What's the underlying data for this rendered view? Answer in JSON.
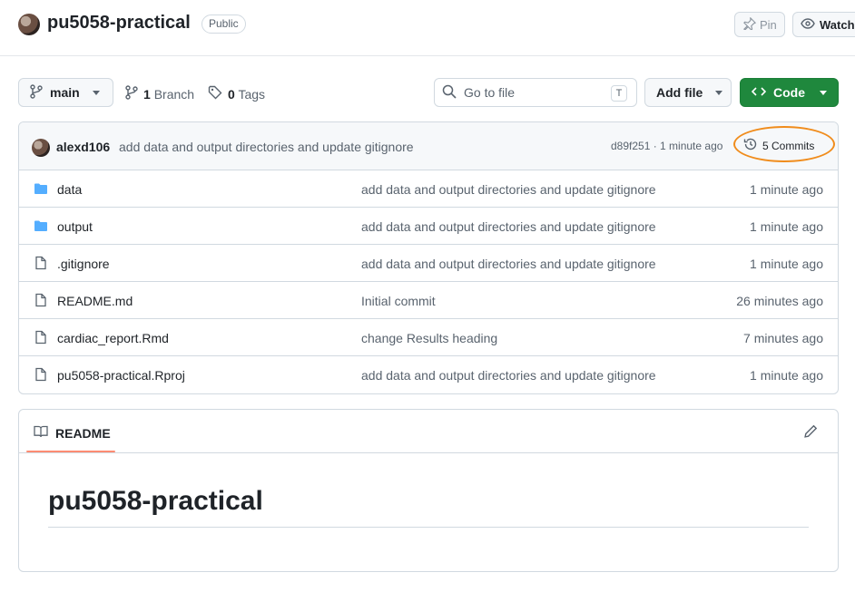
{
  "header": {
    "repo_name": "pu5058-practical",
    "visibility": "Public",
    "pin_label": "Pin",
    "watch_label": "Watch"
  },
  "toolbar": {
    "branch": "main",
    "branch_count": "1",
    "branch_label": "Branch",
    "tag_count": "0",
    "tag_label": "Tags",
    "search_placeholder": "Go to file",
    "search_shortcut": "T",
    "add_file_label": "Add file",
    "code_label": "Code"
  },
  "latest_commit": {
    "author": "alexd106",
    "message": "add data and output directories and update gitignore",
    "hash_time": "d89f251 · 1 minute ago",
    "commits_label": "5 Commits",
    "highlight_color": "#f08c1c"
  },
  "files": [
    {
      "name": "data",
      "type": "folder",
      "message": "add data and output directories and update gitignore",
      "time": "1 minute ago"
    },
    {
      "name": "output",
      "type": "folder",
      "message": "add data and output directories and update gitignore",
      "time": "1 minute ago"
    },
    {
      "name": ".gitignore",
      "type": "file",
      "message": "add data and output directories and update gitignore",
      "time": "1 minute ago"
    },
    {
      "name": "README.md",
      "type": "file",
      "message": "Initial commit",
      "time": "26 minutes ago"
    },
    {
      "name": "cardiac_report.Rmd",
      "type": "file",
      "message": "change Results heading",
      "time": "7 minutes ago"
    },
    {
      "name": "pu5058-practical.Rproj",
      "type": "file",
      "message": "add data and output directories and update gitignore",
      "time": "1 minute ago"
    }
  ],
  "readme": {
    "tab_label": "README",
    "title": "pu5058-practical"
  },
  "colors": {
    "accent_green": "#1f883d",
    "folder_blue": "#54aeff",
    "tab_underline": "#fd8c73"
  }
}
